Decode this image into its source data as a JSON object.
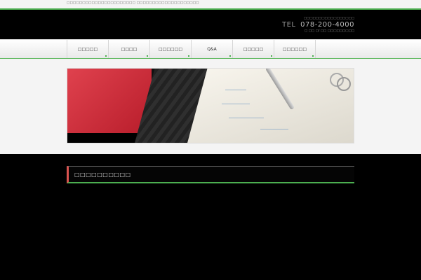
{
  "site": {
    "description": "□□□□□□□□□□□□□□□□□□□□□□ □□□□□□□□□□□□□□□□□□□□"
  },
  "header": {
    "tagline": "□□□□□□□□□□□□□□□□□",
    "tel_prefix": "TEL",
    "phone": "078-200-4000",
    "hours": "□ □□ □/ □□ □□□□□□□□□"
  },
  "nav": {
    "items": [
      "□□□□□",
      "□□□□",
      "□□□□□□",
      "Q&A",
      "□□□□□",
      "□□□□□□"
    ]
  },
  "section": {
    "title": "□□□□□□□□□□"
  },
  "colors": {
    "accent_green": "#4caf50",
    "accent_red": "#d9534f"
  }
}
